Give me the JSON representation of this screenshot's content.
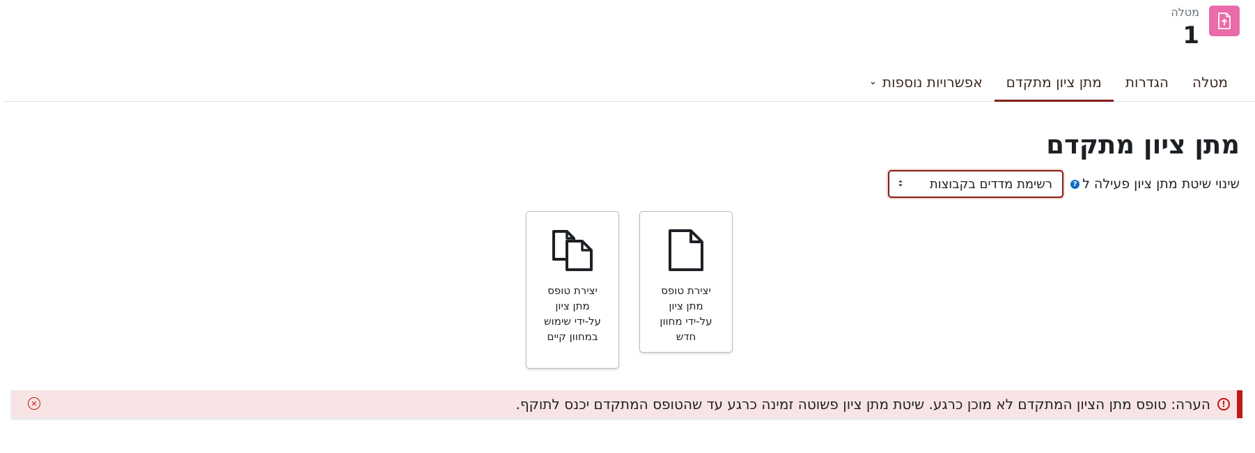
{
  "activity": {
    "type_label": "מטלה",
    "name": "1",
    "icon": "assignment-upload-icon",
    "icon_color": "#e96ba8"
  },
  "tabs": [
    {
      "label": "מטלה",
      "active": false
    },
    {
      "label": "הגדרות",
      "active": false
    },
    {
      "label": "מתן ציון מתקדם",
      "active": true
    },
    {
      "label": "אפשרויות נוספות",
      "active": false,
      "has_dropdown": true
    }
  ],
  "page_title": "מתן ציון מתקדם",
  "method": {
    "label": "שינוי שיטת מתן ציון פעילה ל",
    "selected": "רשימת מדדים בקבוצות"
  },
  "cards": [
    {
      "label": "יצירת טופס מתן ציון על-ידי מחוון חדש",
      "icon": "new-document-icon"
    },
    {
      "label": "יצירת טופס מתן ציון על-ידי שימוש במחוון קיים",
      "icon": "copy-documents-icon"
    }
  ],
  "alert": {
    "text": "הערה: טופס מתן הציון המתקדם לא מוכן כרגע. שיטת מתן ציון פשוטה זמינה כרגע עד שהטופס המתקדם יכנס לתוקף.",
    "color": "#c21818"
  },
  "colors": {
    "accent": "#7f1d17",
    "help": "#0f6cbf"
  }
}
